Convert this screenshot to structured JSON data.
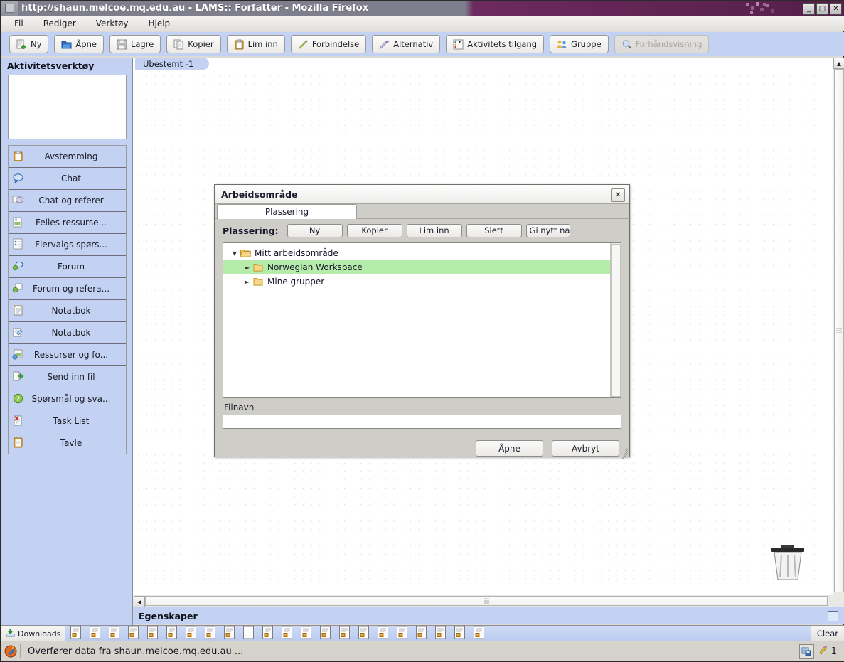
{
  "window": {
    "title": "http://shaun.melcoe.mq.edu.au - LAMS:: Forfatter - Mozilla Firefox",
    "minimize": "_",
    "maximize": "□",
    "close": "✕"
  },
  "menu": {
    "items": [
      {
        "label": "Fil"
      },
      {
        "label": "Rediger"
      },
      {
        "label": "Verktøy"
      },
      {
        "label": "Hjelp"
      }
    ]
  },
  "toolbar": {
    "buttons": [
      {
        "label": "Ny",
        "icon": "new-document-icon",
        "disabled": false
      },
      {
        "label": "Åpne",
        "icon": "open-folder-icon",
        "disabled": false
      },
      {
        "label": "Lagre",
        "icon": "save-disk-icon",
        "disabled": false
      },
      {
        "label": "Kopier",
        "icon": "copy-icon",
        "disabled": false
      },
      {
        "label": "Lim inn",
        "icon": "paste-clipboard-icon",
        "disabled": false
      },
      {
        "label": "Forbindelse",
        "icon": "pencil-icon",
        "disabled": false
      },
      {
        "label": "Alternativ",
        "icon": "highlighter-icon",
        "disabled": false
      },
      {
        "label": "Aktivitets tilgang",
        "icon": "checklist-icon",
        "disabled": false
      },
      {
        "label": "Gruppe",
        "icon": "group-users-icon",
        "disabled": false
      },
      {
        "label": "Forhåndsvisning",
        "icon": "magnifier-icon",
        "disabled": true
      }
    ]
  },
  "sidebar": {
    "header": "Aktivitetsverktøy",
    "items": [
      {
        "label": "Avstemming",
        "icon": "clipboard-orange-icon"
      },
      {
        "label": "Chat",
        "icon": "speech-bubble-icon"
      },
      {
        "label": "Chat og referer",
        "icon": "chat-scribe-icon"
      },
      {
        "label": "Felles ressurse...",
        "icon": "shared-resource-icon"
      },
      {
        "label": "Flervalgs spørs...",
        "icon": "multiple-choice-icon"
      },
      {
        "label": "Forum",
        "icon": "forum-icon"
      },
      {
        "label": "Forum og refera...",
        "icon": "forum-scribe-icon"
      },
      {
        "label": "Notatbok",
        "icon": "notebook-icon"
      },
      {
        "label": "Notatbok",
        "icon": "notebook-pen-icon"
      },
      {
        "label": "Ressurser og fo...",
        "icon": "resources-forum-icon"
      },
      {
        "label": "Send inn fil",
        "icon": "submit-file-icon"
      },
      {
        "label": "Spørsmål og sva...",
        "icon": "question-mark-icon"
      },
      {
        "label": "Task List",
        "icon": "task-list-icon"
      },
      {
        "label": "Tavle",
        "icon": "whiteboard-icon"
      }
    ]
  },
  "canvas": {
    "tab_label": "Ubestemt -1",
    "trash_icon": "trash-can-icon"
  },
  "properties": {
    "label": "Egenskaper",
    "panel_icon": "panel-toggle-icon"
  },
  "dialog": {
    "title": "Arbeidsområde",
    "close_label": "✕",
    "tab_label": "Plassering",
    "tools_label": "Plassering:",
    "tool_buttons": [
      {
        "label": "Ny"
      },
      {
        "label": "Kopier"
      },
      {
        "label": "Lim inn"
      },
      {
        "label": "Slett"
      },
      {
        "label": "Gi nytt na"
      }
    ],
    "tree": [
      {
        "label": "Mitt arbeidsområde",
        "depth": 0,
        "expanded": true,
        "selected": false,
        "twisty": "▼",
        "icon": "folder-open-icon"
      },
      {
        "label": "Norwegian Workspace",
        "depth": 1,
        "expanded": false,
        "selected": true,
        "twisty": "►",
        "icon": "folder-closed-icon"
      },
      {
        "label": "Mine grupper",
        "depth": 1,
        "expanded": false,
        "selected": false,
        "twisty": "►",
        "icon": "folder-closed-icon"
      }
    ],
    "filename_label": "Filnavn",
    "filename_value": "",
    "filename_placeholder": "",
    "open_button": "Åpne",
    "cancel_button": "Avbryt"
  },
  "downloads": {
    "label": "Downloads",
    "icon": "download-arrow-icon",
    "clear_label": "Clear",
    "item_count": 22,
    "item_icon": "file-page-icon"
  },
  "status": {
    "icon": "firefox-busy-icon",
    "text": "Overfører data fra shaun.melcoe.mq.edu.au ...",
    "right_icon": "screen-save-icon",
    "count": "1",
    "count_icon": "wand-icon"
  },
  "colors": {
    "titlebar_purple": "#6d2a5e",
    "toolbar_blue": "#c3d2f2",
    "sidebar_blue": "#c3d2f2",
    "selection_green": "#b6ecaa",
    "dialog_gray": "#cfcdc8"
  }
}
